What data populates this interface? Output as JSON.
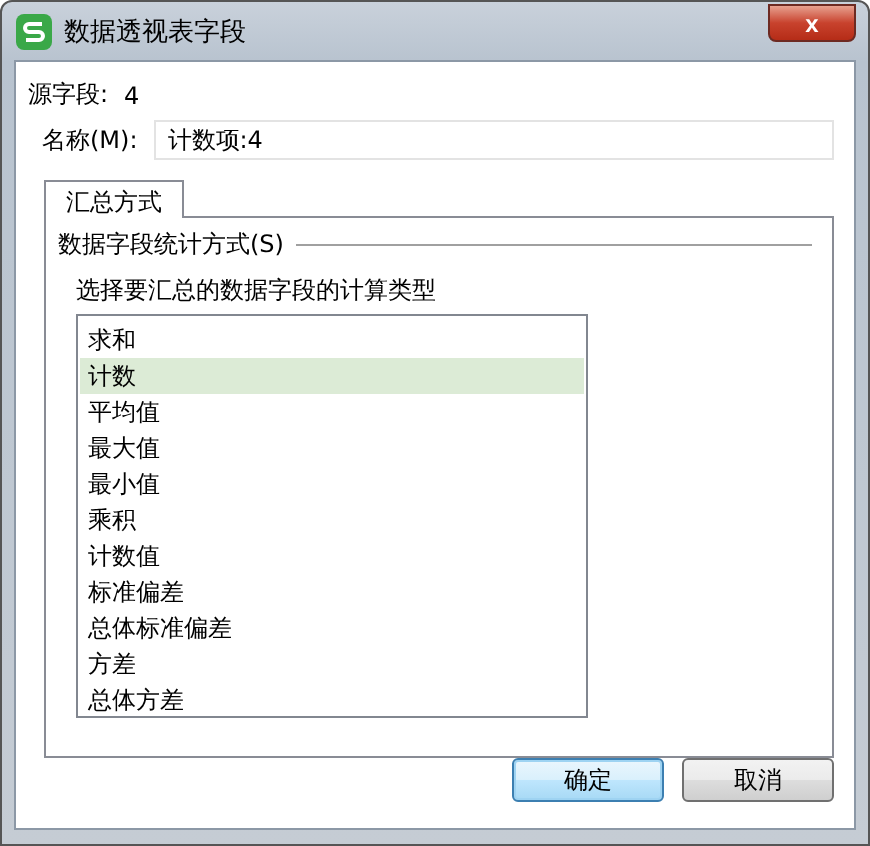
{
  "window": {
    "title": "数据透视表字段",
    "close": "x"
  },
  "source_field": {
    "label": "源字段:",
    "value": "4"
  },
  "name_field": {
    "label": "名称(M):",
    "value": "计数项:4"
  },
  "tabs": [
    {
      "label": "汇总方式",
      "selected": true
    }
  ],
  "group": {
    "label": "数据字段统计方式(S)",
    "instruction": "选择要汇总的数据字段的计算类型"
  },
  "list": {
    "items": [
      {
        "label": "求和",
        "selected": false
      },
      {
        "label": "计数",
        "selected": true
      },
      {
        "label": "平均值",
        "selected": false
      },
      {
        "label": "最大值",
        "selected": false
      },
      {
        "label": "最小值",
        "selected": false
      },
      {
        "label": "乘积",
        "selected": false
      },
      {
        "label": "计数值",
        "selected": false
      },
      {
        "label": "标准偏差",
        "selected": false
      },
      {
        "label": "总体标准偏差",
        "selected": false
      },
      {
        "label": "方差",
        "selected": false
      },
      {
        "label": "总体方差",
        "selected": false
      }
    ]
  },
  "buttons": [
    {
      "label": "确定",
      "default": true
    },
    {
      "label": "取消",
      "default": false
    }
  ]
}
